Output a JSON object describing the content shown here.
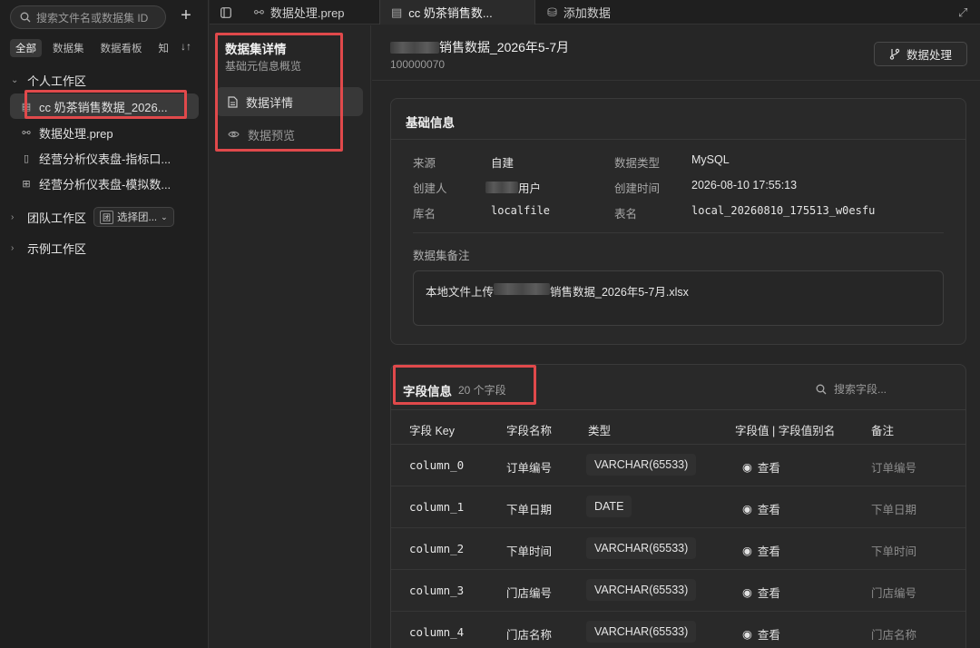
{
  "sidebar": {
    "search_placeholder": "搜索文件名或数据集 ID",
    "add_symbol": "+",
    "filters": [
      "全部",
      "数据集",
      "数据看板",
      "知"
    ],
    "sort_symbol": "↓↑",
    "personal": {
      "label": "个人工作区",
      "items": [
        {
          "icon": "dataset-icon",
          "label": "cc 奶茶销售数据_2026..."
        },
        {
          "icon": "prep-icon",
          "label": "数据处理.prep"
        },
        {
          "icon": "report-icon",
          "label": "经营分析仪表盘-指标口..."
        },
        {
          "icon": "dashboard-icon",
          "label": "经营分析仪表盘-模拟数..."
        }
      ]
    },
    "team": {
      "label": "团队工作区",
      "select_label": "选择团..."
    },
    "example": {
      "label": "示例工作区"
    }
  },
  "tabs": [
    {
      "label": "数据处理.prep"
    },
    {
      "label": "cc 奶茶销售数...",
      "close": "×"
    },
    {
      "label": "添加数据"
    }
  ],
  "innernav": {
    "title": "数据集详情",
    "subtitle": "基础元信息概览",
    "items": [
      {
        "label": "数据详情"
      },
      {
        "label": "数据预览"
      }
    ]
  },
  "header": {
    "title_suffix": "销售数据_2026年5-7月",
    "dataset_id": "100000070",
    "process_button": "数据处理"
  },
  "basic": {
    "title": "基础信息",
    "rows": [
      {
        "k1": "来源",
        "v1": "自建",
        "k2": "数据类型",
        "v2": "MySQL"
      },
      {
        "k1": "创建人",
        "v1": "用户",
        "k2": "创建时间",
        "v2": "2026-08-10 17:55:13"
      },
      {
        "k1": "库名",
        "v1": "localfile",
        "k2": "表名",
        "v2": "local_20260810_175513_w0esfu"
      }
    ],
    "note_label": "数据集备注",
    "note_prefix": "本地文件上传",
    "note_suffix": "销售数据_2026年5-7月.xlsx"
  },
  "fields": {
    "title": "字段信息",
    "count": "20 个字段",
    "search_placeholder": "搜索字段...",
    "columns": [
      "字段 Key",
      "字段名称",
      "类型",
      "字段值 | 字段值别名",
      "备注"
    ],
    "rows": [
      {
        "key": "column_0",
        "name": "订单编号",
        "type": "VARCHAR(65533)",
        "view": "查看",
        "remark": "订单编号"
      },
      {
        "key": "column_1",
        "name": "下单日期",
        "type": "DATE",
        "view": "查看",
        "remark": "下单日期"
      },
      {
        "key": "column_2",
        "name": "下单时间",
        "type": "VARCHAR(65533)",
        "view": "查看",
        "remark": "下单时间"
      },
      {
        "key": "column_3",
        "name": "门店编号",
        "type": "VARCHAR(65533)",
        "view": "查看",
        "remark": "门店编号"
      },
      {
        "key": "column_4",
        "name": "门店名称",
        "type": "VARCHAR(65533)",
        "view": "查看",
        "remark": "门店名称"
      }
    ]
  },
  "colors": {
    "highlight": "#e0494b",
    "background": "#262626",
    "sidebar": "#1f1f1f"
  }
}
